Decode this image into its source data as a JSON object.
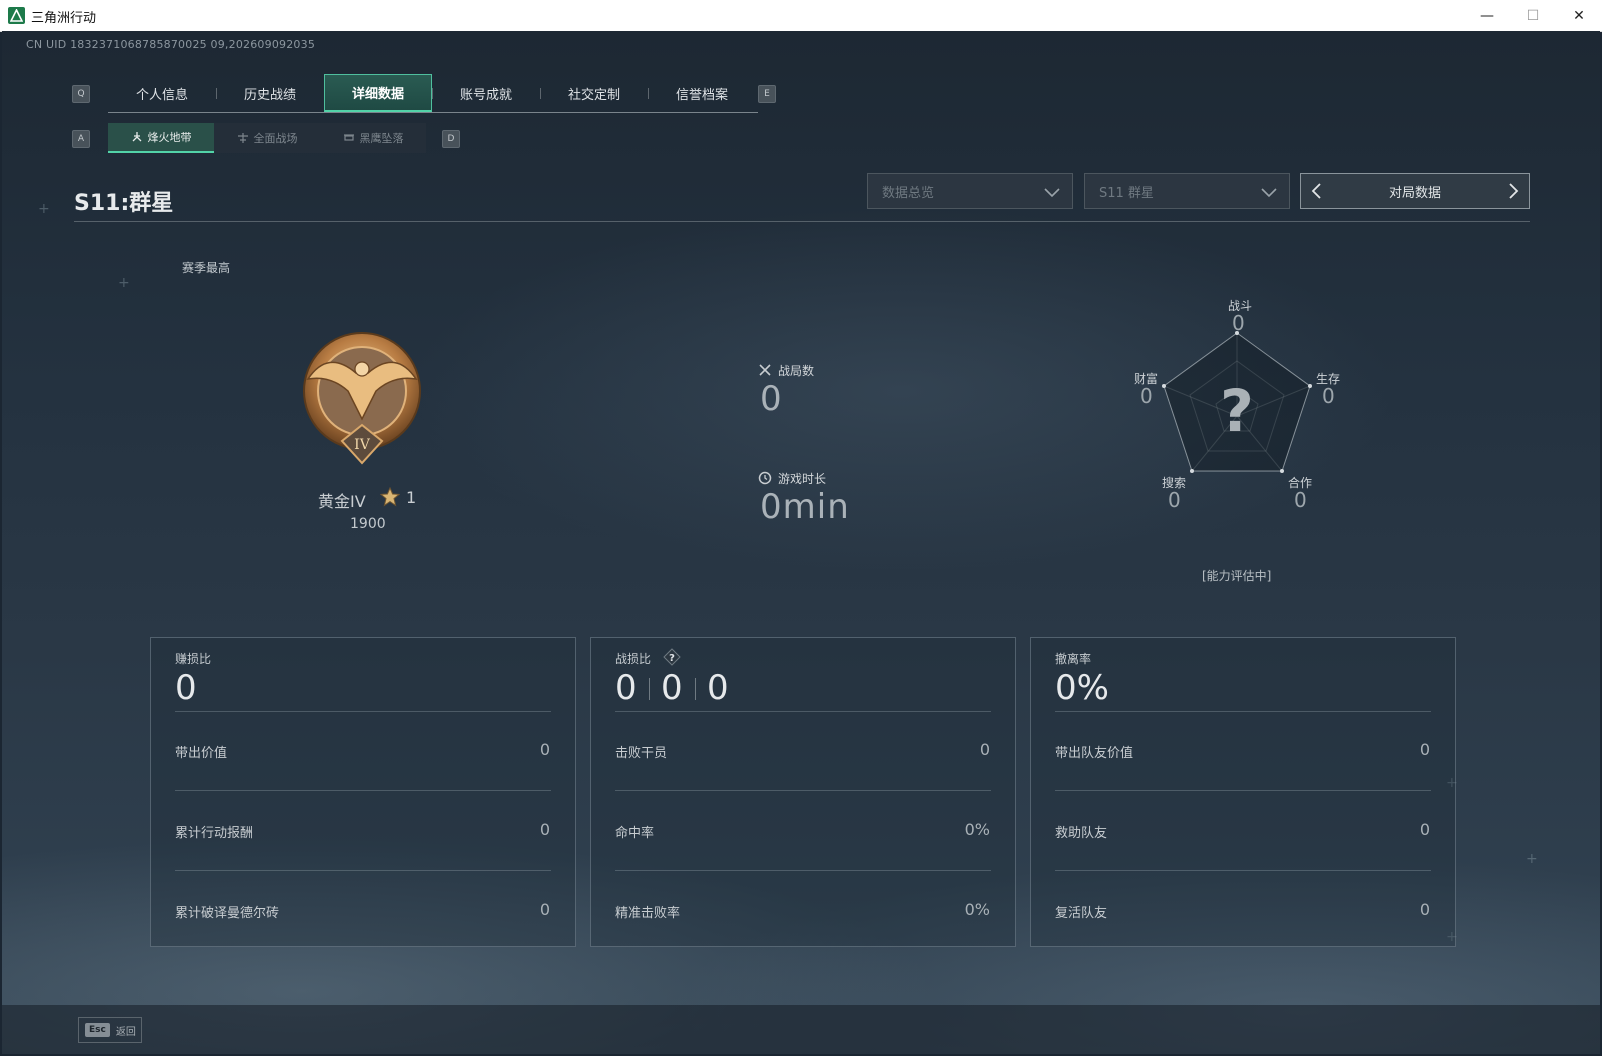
{
  "window": {
    "title": "三角洲行动",
    "controls": {
      "minimize": "—",
      "maximize": "☐",
      "close": "✕"
    }
  },
  "uid": "CN UID 1832371068785870025 09,202609092035",
  "ghost_heading": "",
  "keys": {
    "tab_prev": "Q",
    "tab_next": "E",
    "sub_prev": "A",
    "sub_next": "D"
  },
  "main_tabs": [
    "个人信息",
    "历史战绩",
    "详细数据",
    "账号成就",
    "社交定制",
    "信誉档案"
  ],
  "main_tab_active": "详细数据",
  "sub_tabs": [
    "烽火地带",
    "全面战场",
    "黑鹰坠落"
  ],
  "sub_tab_active": "烽火地带",
  "season": {
    "title": "S11:群星"
  },
  "filters": {
    "overview": "数据总览",
    "season": "S11 群星",
    "mode": "对局数据"
  },
  "rank": {
    "label": "赛季最高",
    "tier_numeral": "IV",
    "name": "黄金IV",
    "stars": "1",
    "score": "1900"
  },
  "battles": {
    "label": "战局数",
    "value": "0"
  },
  "playtime": {
    "label": "游戏时长",
    "value": "0min"
  },
  "radar": {
    "center_mark": "?",
    "status": "[能力评估中]",
    "axes": [
      {
        "label": "战斗",
        "value": "0"
      },
      {
        "label": "生存",
        "value": "0"
      },
      {
        "label": "合作",
        "value": "0"
      },
      {
        "label": "搜索",
        "value": "0"
      },
      {
        "label": "财富",
        "value": "0"
      }
    ]
  },
  "cards": [
    {
      "title": "赚损比",
      "big": "0",
      "rows": [
        {
          "label": "带出价值",
          "value": "0"
        },
        {
          "label": "累计行动报酬",
          "value": "0"
        },
        {
          "label": "累计破译曼德尔砖",
          "value": "0"
        }
      ]
    },
    {
      "title": "战损比",
      "help": "?",
      "big_parts": [
        "0",
        "0",
        "0"
      ],
      "rows": [
        {
          "label": "击败干员",
          "value": "0"
        },
        {
          "label": "命中率",
          "value": "0%"
        },
        {
          "label": "精准击败率",
          "value": "0%"
        }
      ]
    },
    {
      "title": "撤离率",
      "big": "0%",
      "rows": [
        {
          "label": "带出队友价值",
          "value": "0"
        },
        {
          "label": "救助队友",
          "value": "0"
        },
        {
          "label": "复活队友",
          "value": "0"
        }
      ]
    }
  ],
  "footer": {
    "esc_key": "Esc",
    "back_label": "返回"
  },
  "colors": {
    "accent": "#52d3a8",
    "tab_active_bg": "#2a5b52",
    "medal_gold": "#c08a4e"
  }
}
